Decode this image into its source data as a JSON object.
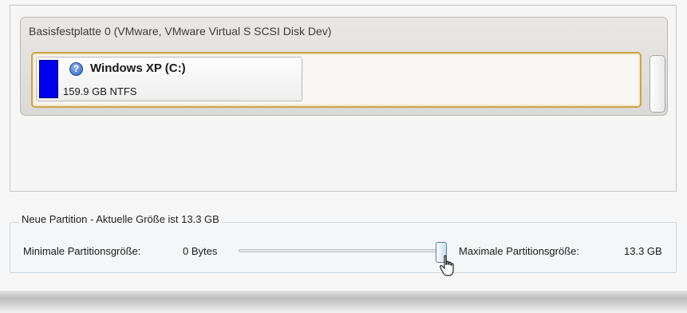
{
  "disk": {
    "title": "Basisfestplatte 0 (VMware, VMware Virtual S SCSI Disk Dev)",
    "partitions": [
      {
        "name": "Windows XP (C:)",
        "size": "159.9 GB NTFS",
        "icon": "help-icon",
        "icon_glyph": "?",
        "color": "#0000EE"
      }
    ]
  },
  "new_partition": {
    "title": "Neue Partition - Aktuelle Größe ist 13.3 GB",
    "min_label": "Minimale Partitionsgröße:",
    "min_value": "0 Bytes",
    "max_label": "Maximale Partitionsgröße:",
    "max_value": "13.3 GB",
    "slider_level": 1.0
  }
}
